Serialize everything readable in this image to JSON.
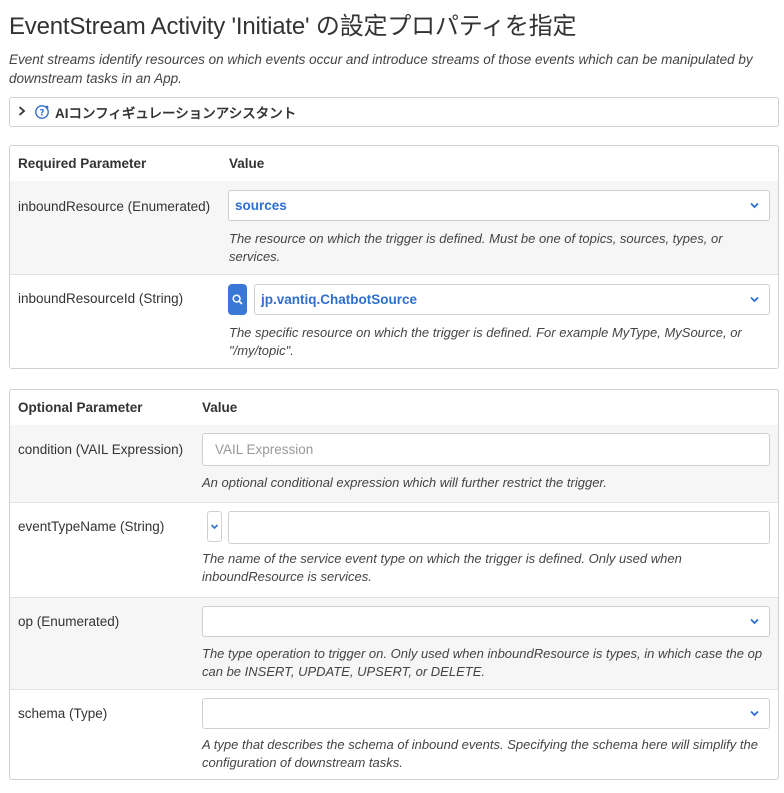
{
  "title": "EventStream Activity 'Initiate' の設定プロパティを指定",
  "description": "Event streams identify resources on which events occur and introduce streams of those events which can be manipulated by downstream tasks in an App.",
  "ai_assistant": {
    "label": "AIコンフィギュレーションアシスタント"
  },
  "required": {
    "header_param": "Required Parameter",
    "header_value": "Value",
    "params": [
      {
        "label": "inboundResource (Enumerated)",
        "value": "sources",
        "help": "The resource on which the trigger is defined. Must be one of topics, sources, types, or services."
      },
      {
        "label": "inboundResourceId (String)",
        "value": "jp.vantiq.ChatbotSource",
        "help": "The specific resource on which the trigger is defined. For example MyType, MySource, or \"/my/topic\"."
      }
    ]
  },
  "optional": {
    "header_param": "Optional Parameter",
    "header_value": "Value",
    "params": [
      {
        "label": "condition (VAIL Expression)",
        "placeholder": "VAIL Expression",
        "help": "An optional conditional expression which will further restrict the trigger."
      },
      {
        "label": "eventTypeName (String)",
        "value": "",
        "help": "The name of the service event type on which the trigger is defined. Only used when inboundResource is services."
      },
      {
        "label": "op (Enumerated)",
        "value": "",
        "help": "The type operation to trigger on. Only used when inboundResource is types, in which case the op can be INSERT, UPDATE, UPSERT, or DELETE."
      },
      {
        "label": "schema (Type)",
        "value": "",
        "help": "A type that describes the schema of inbound events. Specifying the schema here will simplify the configuration of downstream tasks."
      }
    ]
  },
  "colors": {
    "accent": "#2f6fce",
    "button": "#3a78d6",
    "row_shade": "#f6f6f6"
  },
  "icons": [
    "chevron-right-icon",
    "ai-assistant-icon",
    "chevron-down-icon",
    "search-icon"
  ]
}
